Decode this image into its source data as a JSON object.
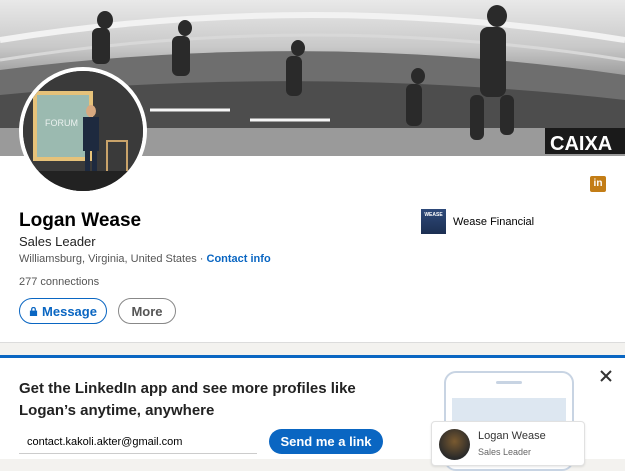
{
  "profile": {
    "name": "Logan Wease",
    "headline": "Sales Leader",
    "location": "Williamsburg, Virginia, United States",
    "separator": "·",
    "contact_info": "Contact info",
    "connections": "277 connections",
    "company": "Wease Financial",
    "company_logo_text": "WEASE",
    "linkedin_badge": "in"
  },
  "actions": {
    "message": "Message",
    "more": "More"
  },
  "promo": {
    "title": "Get the LinkedIn app and see more profiles like Logan’s anytime, anywhere",
    "email_value": "contact.kakoli.akter@gmail.com",
    "send_label": "Send me a link",
    "mini_name": "Logan Wease",
    "mini_headline": "Sales Leader"
  },
  "colors": {
    "accent": "#0a66c2",
    "linkedin_badge": "#c37d16"
  }
}
